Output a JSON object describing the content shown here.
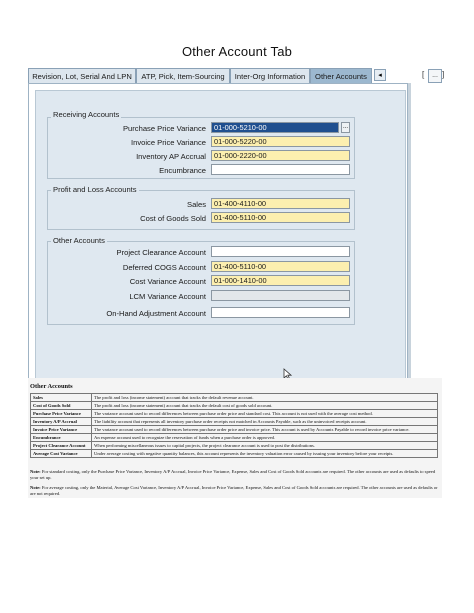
{
  "page": {
    "title": "Other Account Tab"
  },
  "tabs": [
    {
      "label": "Revision, Lot, Serial And LPN",
      "active": false
    },
    {
      "label": "ATP, Pick, Item-Sourcing",
      "active": false
    },
    {
      "label": "Inter-Org Information",
      "active": false
    },
    {
      "label": "Other Accounts",
      "active": true
    }
  ],
  "tab_controls": {
    "scroll_left": "◂",
    "more_open": "[",
    "more_dots": "...",
    "more_close": "]"
  },
  "receiving": {
    "title": "Receiving Accounts",
    "ppv_label": "Purchase Price Variance",
    "ppv_value": "01-000-5210-00",
    "lov": "...",
    "ipv_label": "Invoice Price Variance",
    "ipv_value": "01-000-5220-00",
    "inv_ap_label": "Inventory AP Accrual",
    "inv_ap_value": "01-000-2220-00",
    "encumbrance_label": "Encumbrance",
    "encumbrance_value": ""
  },
  "profit_loss": {
    "title": "Profit and Loss Accounts",
    "sales_label": "Sales",
    "sales_value": "01-400-4110-00",
    "cogs_label": "Cost of Goods Sold",
    "cogs_value": "01-400-5110-00"
  },
  "other": {
    "title": "Other Accounts",
    "project_clearance_label": "Project Clearance Account",
    "project_clearance_value": "",
    "deferred_cogs_label": "Deferred COGS Account",
    "deferred_cogs_value": "01-400-5110-00",
    "cost_variance_label": "Cost Variance Account",
    "cost_variance_value": "01-000-1410-00",
    "lcm_variance_label": "LCM Variance Account",
    "lcm_variance_value": "",
    "onhand_adj_label": "On-Hand Adjustment Account",
    "onhand_adj_value": ""
  },
  "doc": {
    "heading": "Other Accounts",
    "rows": [
      {
        "term": "Sales",
        "definition": "The profit and loss (income statement) account that tracks the default revenue account."
      },
      {
        "term": "Cost of Goods Sold",
        "definition": "The profit and loss (income statement) account that tracks the default cost of goods sold account."
      },
      {
        "term": "Purchase Price Variance",
        "definition": "The variance account used to record differences between purchase order price and standard cost. This account is not used with the average cost method."
      },
      {
        "term": "Inventory A/P Accrual",
        "definition": "The liability account that represents all inventory purchase order receipts not matched in Accounts Payable, such as the uninvoiced receipts account."
      },
      {
        "term": "Invoice Price Variance",
        "definition": "The variance account used to record differences between purchase order price and invoice price. This account is used by Accounts Payable to record invoice price variance."
      },
      {
        "term": "Encumbrance",
        "definition": "An expense account used to recognize the reservation of funds when a purchase order is approved."
      },
      {
        "term": "Project Clearance Account",
        "definition": "When performing miscellaneous issues to capital projects, the project clearance account is used to post the distributions."
      },
      {
        "term": "Average Cost Variance",
        "definition": "Under average costing with negative quantity balances, this account represents the inventory valuation error caused by issuing your inventory before your receipts."
      }
    ],
    "note1_label": "Note:",
    "note1_text": " For standard costing, only the Purchase Price Variance, Inventory A/P Accrual, Invoice Price Variance, Expense, Sales and Cost of Goods Sold accounts are required. The other accounts are used as defaults to speed your set up.",
    "note2_label": "Note:",
    "note2_text": " For average costing, only the Material, Average Cost Variance, Inventory A/P Accrual, Invoice Price Variance, Expense, Sales and Cost of Goods Sold accounts are required. The other accounts are used as defaults or are not required."
  },
  "colors": {
    "required_field": "#fcefaf",
    "selected_field": "#1f4f8f",
    "panel_bg": "#dfe8f0",
    "active_tab": "#9cb8cf"
  }
}
